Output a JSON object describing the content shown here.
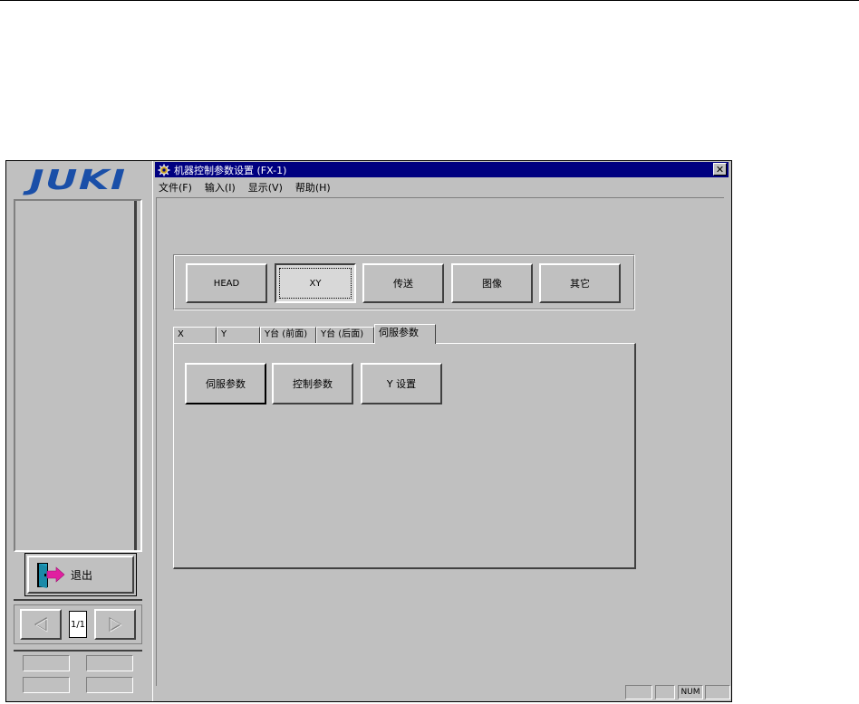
{
  "left_panel": {
    "logo_text": "JUKI",
    "exit_label": "退出",
    "page_indicator": "1/1"
  },
  "window": {
    "title": "机器控制参数设置 (FX-1)",
    "close_glyph": "✕",
    "menu": [
      {
        "label": "文件(F)"
      },
      {
        "label": "输入(I)"
      },
      {
        "label": "显示(V)"
      },
      {
        "label": "帮助(H)"
      }
    ]
  },
  "category_buttons": [
    {
      "label": "HEAD",
      "pressed": false
    },
    {
      "label": "XY",
      "pressed": true
    },
    {
      "label": "传送",
      "pressed": false
    },
    {
      "label": "图像",
      "pressed": false
    },
    {
      "label": "其它",
      "pressed": false
    }
  ],
  "tabs": [
    {
      "label": "X",
      "active": false
    },
    {
      "label": "Y",
      "active": false
    },
    {
      "label": "Y台 (前面)",
      "active": false
    },
    {
      "label": "Y台 (后面)",
      "active": false
    },
    {
      "label": "伺服参数",
      "active": true
    }
  ],
  "panel_buttons": [
    {
      "label": "伺服参数"
    },
    {
      "label": "控制参数"
    },
    {
      "label": "Y 设置"
    }
  ],
  "status_bar": {
    "num_indicator": "NUM"
  },
  "colors": {
    "face": "#c0c0c0",
    "title_bar": "#000080",
    "logo": "#1a4fa8",
    "exit_arrow": "#e020a0",
    "door": "#20a0c0"
  }
}
